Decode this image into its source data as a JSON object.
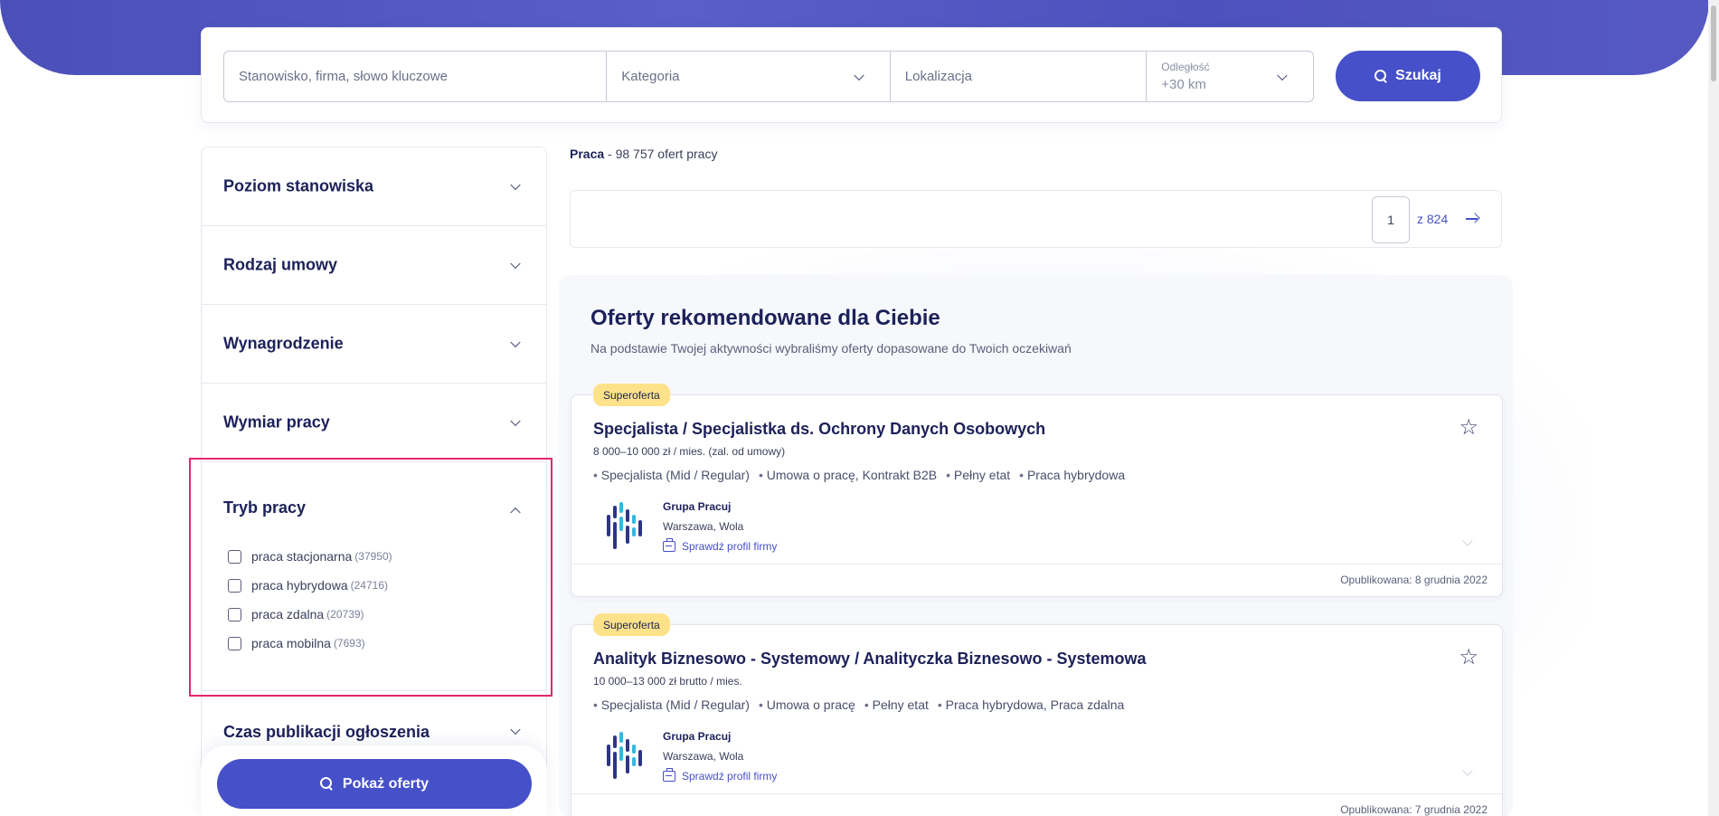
{
  "search": {
    "keyword_placeholder": "Stanowisko, firma, słowo kluczowe",
    "category_placeholder": "Kategoria",
    "location_placeholder": "Lokalizacja",
    "distance_label": "Odległość",
    "distance_value": "+30 km",
    "button_label": "Szukaj"
  },
  "filters": {
    "level": "Poziom stanowiska",
    "contract": "Rodzaj umowy",
    "salary": "Wynagrodzenie",
    "worktime": "Wymiar pracy",
    "mode": {
      "title": "Tryb pracy",
      "options": [
        {
          "label": "praca stacjonarna",
          "count": "(37950)"
        },
        {
          "label": "praca hybrydowa",
          "count": "(24716)"
        },
        {
          "label": "praca zdalna",
          "count": "(20739)"
        },
        {
          "label": "praca mobilna",
          "count": "(7693)"
        }
      ]
    },
    "published": "Czas publikacji ogłoszenia",
    "show_button": "Pokaż oferty"
  },
  "results": {
    "prefix": "Praca",
    "count_text": " - 98 757 ofert pracy",
    "page": "1",
    "page_of": "z  824"
  },
  "recommended": {
    "title": "Oferty rekomendowane dla Ciebie",
    "subtitle": "Na podstawie Twojej aktywności wybraliśmy oferty dopasowane do Twoich oczekiwań"
  },
  "offers": [
    {
      "badge": "Superoferta",
      "title": "Specjalista / Specjalistka ds. Ochrony Danych Osobowych",
      "salary": "8 000–10 000 zł / mies. (zal. od umowy)",
      "tags": [
        "Specjalista (Mid / Regular)",
        "Umowa o pracę, Kontrakt B2B",
        "Pełny etat",
        "Praca hybrydowa"
      ],
      "company": "Grupa Pracuj",
      "city": "Warszawa, Wola",
      "profile_link": "Sprawdź profil firmy",
      "published": "Opublikowana: 8 grudnia 2022"
    },
    {
      "badge": "Superoferta",
      "title": "Analityk Biznesowo - Systemowy / Analityczka Biznesowo - Systemowa",
      "salary": "10 000–13 000 zł brutto / mies.",
      "tags": [
        "Specjalista (Mid / Regular)",
        "Umowa o pracę",
        "Pełny etat",
        "Praca hybrydowa, Praca zdalna"
      ],
      "company": "Grupa Pracuj",
      "city": "Warszawa, Wola",
      "profile_link": "Sprawdź profil firmy",
      "published": "Opublikowana: 7 grudnia 2022"
    }
  ],
  "colors": {
    "brand": "#4650c8",
    "highlight": "#e2266e",
    "badge": "#fde28a"
  }
}
